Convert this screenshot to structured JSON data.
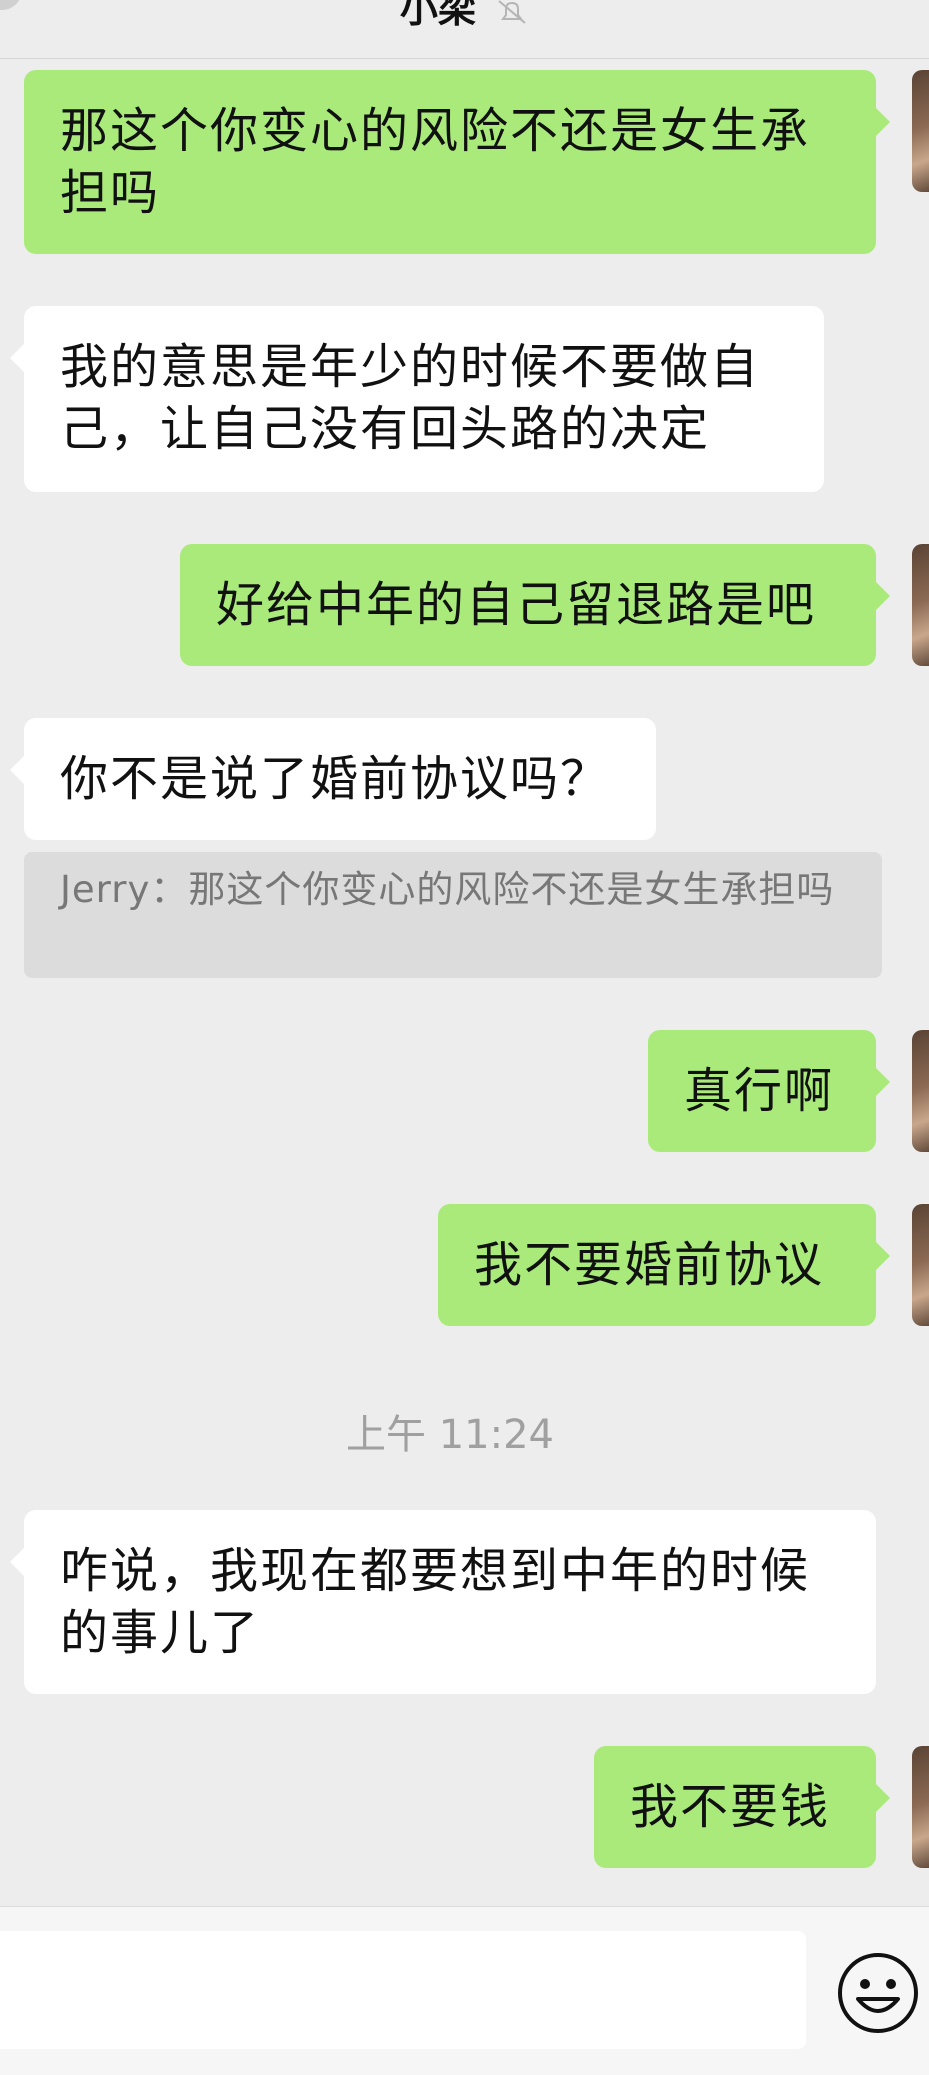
{
  "header": {
    "title": "小梁"
  },
  "messages": [
    {
      "id": "m1",
      "side": "out",
      "text": "那这个你变心的风险不还是女生承担吗"
    },
    {
      "id": "m2",
      "side": "in",
      "text": "我的意思是年少的时候不要做自己，让自己没有回头路的决定"
    },
    {
      "id": "m3",
      "side": "out",
      "text": "好给中年的自己留退路是吧"
    },
    {
      "id": "m4",
      "side": "in",
      "text": "你不是说了婚前协议吗？"
    },
    {
      "id": "m5",
      "side": "out",
      "text": "真行啊"
    },
    {
      "id": "m6",
      "side": "out",
      "text": "我不要婚前协议"
    },
    {
      "id": "m7",
      "side": "in",
      "text": "咋说，我现在都要想到中年的时候的事儿了"
    },
    {
      "id": "m8",
      "side": "out",
      "text": "我不要钱"
    }
  ],
  "quote": {
    "text": "Jerry：那这个你变心的风险不还是女生承担吗"
  },
  "timestamp": "上午 11:24",
  "input": {
    "placeholder": "",
    "emoji_icon": "smiley-icon"
  },
  "colors": {
    "outgoing_bubble": "#a9ea7a",
    "incoming_bubble": "#ffffff",
    "background": "#ededed"
  }
}
